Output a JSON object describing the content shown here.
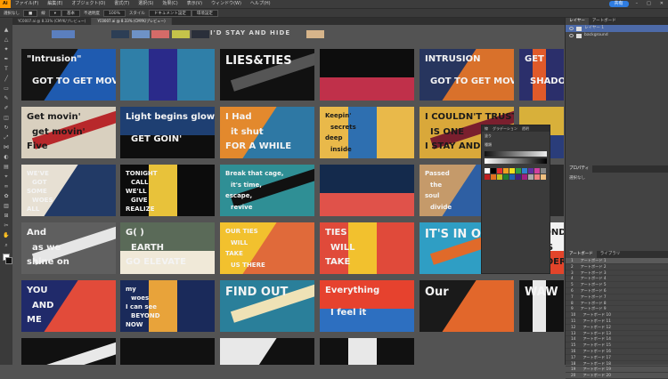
{
  "menubar": {
    "items": [
      "ファイル(F)",
      "編集(E)",
      "オブジェクト(O)",
      "書式(T)",
      "選択(S)",
      "効果(C)",
      "表示(V)",
      "ウィンドウ(W)",
      "ヘルプ(H)"
    ],
    "share_label": "共有"
  },
  "options_bar": {
    "selection_label": "選択なし",
    "stroke_label": "線",
    "brush_label": "基本",
    "opacity_label": "不透明度",
    "opacity_value": "100%",
    "style_label": "スタイル",
    "doc_setup_label": "ドキュメント設定",
    "prefs_label": "環境設定"
  },
  "tabs": [
    {
      "label": "YC0007.ai @ 8.33% (CMYK/プレビュー)",
      "active": false
    },
    {
      "label": "YC0007.ai @ 8.33% (CMYK/プレビュー)",
      "active": true
    }
  ],
  "canvas": {
    "palette_colors": [
      "#5b7fbe",
      "#2c3e55",
      "#6e92c6",
      "#d46b68",
      "#c5c34a",
      "#2a2f3a",
      "#3e7c8c",
      "#d6b48a"
    ],
    "headline": "I'D STAY AND HIDE"
  },
  "cards": [
    {
      "bg": "#1f5bb0",
      "accent": "#141414",
      "texts": [
        "\"Intrusion\"",
        "GOT TO GET MOVIN'"
      ]
    },
    {
      "bg": "#2f7fa8",
      "accent": "#2a2a8a",
      "texts": []
    },
    {
      "bg": "#111111",
      "accent": "#555555",
      "texts": [
        "LIES&TIES"
      ]
    },
    {
      "bg": "#0d0d0d",
      "accent": "#c0304a",
      "texts": []
    },
    {
      "bg": "#d9712b",
      "accent": "#27355e",
      "texts": [
        "INTRUSION",
        "GOT TO GET MOVIN'"
      ]
    },
    {
      "bg": "#2b2f6b",
      "accent": "#e05a2a",
      "texts": [
        "GET",
        "SHADOWS"
      ]
    },
    {
      "bg": "#d9d0bf",
      "accent": "#b8282b",
      "texts": [
        "Get movin'",
        "get movin'",
        "Five"
      ]
    },
    {
      "bg": "#1e3f72",
      "accent": "#0e0e0e",
      "texts": [
        "Light begins glowin",
        "GET GOIN'"
      ]
    },
    {
      "bg": "#2e78a4",
      "accent": "#e3892d",
      "texts": [
        "I Had",
        "it shut",
        "FOR A WHILE"
      ]
    },
    {
      "bg": "#e9b94a",
      "accent": "#2e6fb0",
      "texts": [
        "Keepin'",
        "secrets",
        "deep",
        "inside"
      ]
    },
    {
      "bg": "#d9a83a",
      "accent": "#7a1f2e",
      "texts": [
        "I COULDN'T TRUST",
        "IS ONE",
        "I STAY AND"
      ]
    },
    {
      "bg": "#d8b03a",
      "accent": "#2a3d7a",
      "texts": []
    },
    {
      "bg": "#223a66",
      "accent": "#e7e0d3",
      "texts": [
        "WE'VE",
        "GOT",
        "SOME",
        "WOES",
        "ALL"
      ]
    },
    {
      "bg": "#0c0c0c",
      "accent": "#e8c23a",
      "texts": [
        "TONIGHT",
        "CALL",
        "WE'LL",
        "GIVE",
        "REALIZE"
      ]
    },
    {
      "bg": "#2f8f95",
      "accent": "#111111",
      "texts": [
        "Break that cage,",
        "it's time,",
        "escape,",
        "revive"
      ]
    },
    {
      "bg": "#142a4c",
      "accent": "#e0524a",
      "texts": []
    },
    {
      "bg": "#2e5fa3",
      "accent": "#c59a6a",
      "texts": [
        "Passed",
        "the",
        "soul",
        "divide"
      ]
    },
    {
      "bg": "#2a2a2a",
      "accent": "#c9c9c9",
      "texts": []
    },
    {
      "bg": "#5f5f5f",
      "accent": "#e6e6e6",
      "texts": [
        "And",
        "as we",
        "shine on"
      ]
    },
    {
      "bg": "#5a6a58",
      "accent": "#f0e9d8",
      "texts": [
        "G( )",
        "EARTH",
        "GO ELEVATE"
      ]
    },
    {
      "bg": "#e06a3a",
      "accent": "#f2c12e",
      "texts": [
        "OUR TIES",
        "WILL",
        "TAKE",
        "US THERE"
      ]
    },
    {
      "bg": "#e04a3a",
      "accent": "#f2c12e",
      "texts": [
        "TIES",
        "WILL",
        "TAKE"
      ]
    },
    {
      "bg": "#2f9ec4",
      "accent": "#e06a2a",
      "texts": [
        "IT'S IN OUR SIGHT"
      ]
    },
    {
      "bg": "#f2f2f2",
      "accent": "#e3442a",
      "texts": [
        "BEYOND",
        "THIS",
        "BORDER"
      ]
    },
    {
      "bg": "#e24b3a",
      "accent": "#202a6a",
      "texts": [
        "YOU",
        "AND",
        "ME"
      ]
    },
    {
      "bg": "#1a2a5a",
      "accent": "#e8a33a",
      "texts": [
        "my",
        "woes",
        "I can see",
        "BEYOND",
        "NOW"
      ]
    },
    {
      "bg": "#2a7f9a",
      "accent": "#efe2b6",
      "texts": [
        "FIND OUT"
      ]
    },
    {
      "bg": "#e6422e",
      "accent": "#2d6fc0",
      "texts": [
        "Everything",
        "I feel it"
      ]
    },
    {
      "bg": "#e2672b",
      "accent": "#1a1a1a",
      "texts": [
        "Our"
      ]
    },
    {
      "bg": "#111111",
      "accent": "#e8e8e8",
      "texts": [
        "WAW"
      ]
    },
    {
      "bg": "#111111",
      "accent": "#e8e8e8",
      "texts": []
    },
    {
      "bg": "#111111",
      "accent": "#e8e8e8",
      "texts": []
    },
    {
      "bg": "#111111",
      "accent": "#e8e8e8",
      "texts": []
    },
    {
      "bg": "#111111",
      "accent": "#e8e8e8",
      "texts": []
    }
  ],
  "float_panel": {
    "tabs": [
      "線",
      "グラデーション",
      "透明"
    ],
    "fill_label": "塗り",
    "type_label": "種類",
    "swatch_colors": [
      "#ffffff",
      "#000000",
      "#e63030",
      "#f0a020",
      "#f0e020",
      "#30a040",
      "#3080d0",
      "#6030a0",
      "#d040a0",
      "#888888",
      "#c02020",
      "#e07020",
      "#c0c020",
      "#208030",
      "#2060b0",
      "#402080",
      "#a02080",
      "#aaaaaa",
      "#f08080",
      "#f0c080"
    ]
  },
  "right_panel": {
    "tabs": [
      "レイヤー",
      "アートボード"
    ],
    "layers": [
      {
        "name": "レイヤー 1",
        "selected": true
      },
      {
        "name": "background",
        "selected": false
      }
    ],
    "props_title": "プロパティ",
    "props_sub": "選択なし",
    "artboards_tabs": [
      "アートボード",
      "ライブラリ"
    ],
    "artboards": [
      "アートボード 1",
      "アートボード 2",
      "アートボード 3",
      "アートボード 4",
      "アートボード 5",
      "アートボード 6",
      "アートボード 7",
      "アートボード 8",
      "アートボード 9",
      "アートボード 10",
      "アートボード 11",
      "アートボード 12",
      "アートボード 13",
      "アートボード 14",
      "アートボード 15",
      "アートボード 16",
      "アートボード 17",
      "アートボード 18",
      "アートボード 19",
      "アートボード 20"
    ]
  }
}
